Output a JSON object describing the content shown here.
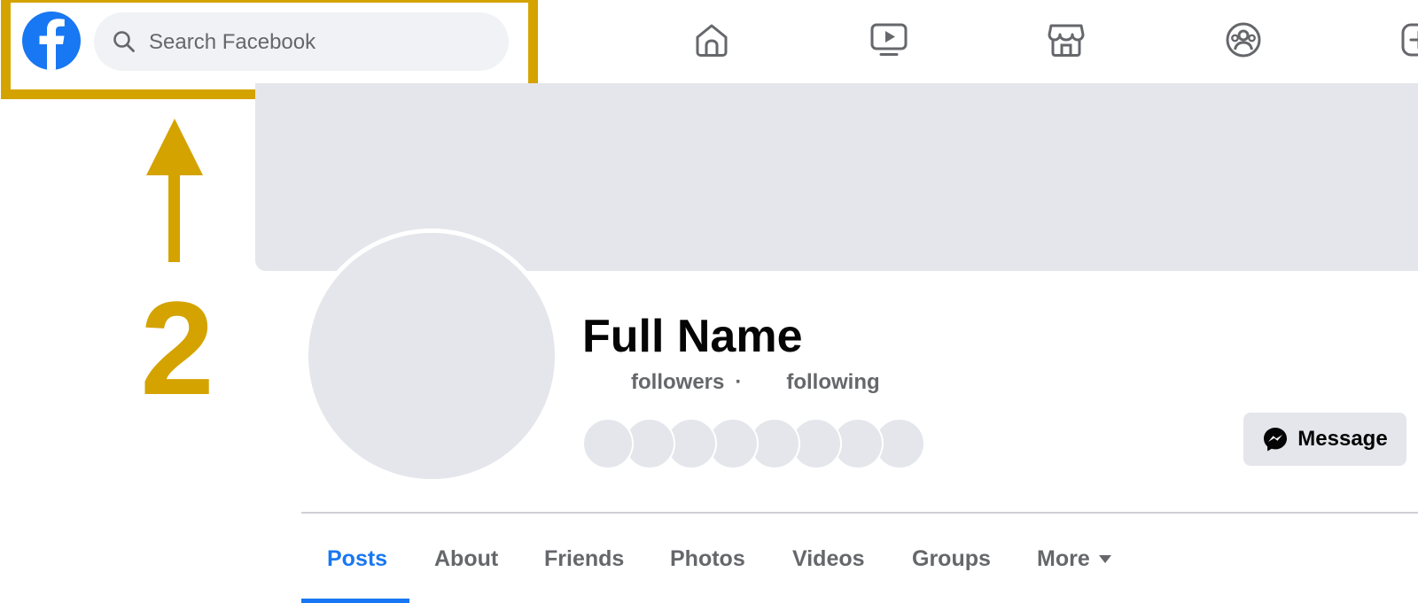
{
  "colors": {
    "brand": "#1877f2",
    "annotation": "#d4a300",
    "placeholder_gray": "#e4e6eb",
    "secondary_text": "#65676b"
  },
  "header": {
    "logo_icon": "facebook-logo",
    "search": {
      "placeholder": "Search Facebook",
      "value": "",
      "icon": "search-icon"
    },
    "nav_icons": [
      "home-icon",
      "watch-icon",
      "marketplace-icon",
      "groups-icon",
      "create-icon"
    ]
  },
  "annotation": {
    "number": "2",
    "arrow_icon": "up-arrow-icon"
  },
  "profile": {
    "name": "Full Name",
    "followers_label": "followers",
    "separator": "·",
    "following_label": "following",
    "friend_avatar_count": 8,
    "message_button": {
      "label": "Message",
      "icon": "messenger-icon"
    }
  },
  "tabs": [
    {
      "label": "Posts",
      "active": true
    },
    {
      "label": "About",
      "active": false
    },
    {
      "label": "Friends",
      "active": false
    },
    {
      "label": "Photos",
      "active": false
    },
    {
      "label": "Videos",
      "active": false
    },
    {
      "label": "Groups",
      "active": false
    },
    {
      "label": "More",
      "active": false,
      "dropdown": true
    }
  ]
}
